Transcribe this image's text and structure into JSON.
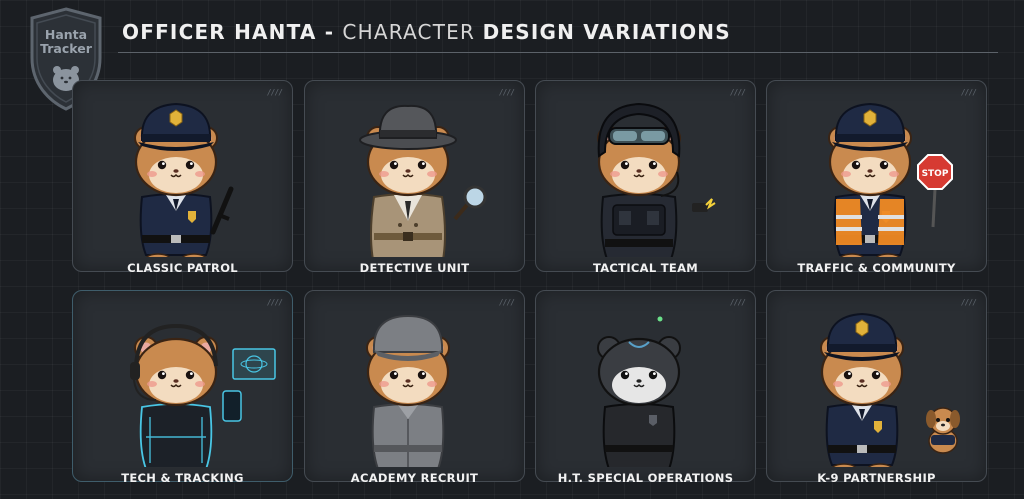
{
  "badge": {
    "line1": "Hanta",
    "line2": "Tracker"
  },
  "header": {
    "title_part1": "OFFICER HANTA - ",
    "title_part2": "CHARACTER ",
    "title_part3": "DESIGN VARIATIONS"
  },
  "cards": [
    {
      "label": "CLASSIC PATROL"
    },
    {
      "label": "DETECTIVE UNIT"
    },
    {
      "label": "TACTICAL TEAM"
    },
    {
      "label": "TRAFFIC & COMMUNITY"
    },
    {
      "label": "TECH & TRACKING"
    },
    {
      "label": "ACADEMY RECRUIT"
    },
    {
      "label": "H.T. SPECIAL OPERATIONS"
    },
    {
      "label": "K-9 PARTNERSHIP"
    }
  ],
  "stop_sign_text": "STOP",
  "colors": {
    "background": "#1b1e22",
    "card": "#2a2e33",
    "fur": "#c98a4f",
    "police_navy": "#1f2a44",
    "trench_coat": "#a89478",
    "tech_glow": "#49c6e5",
    "recruit_gray": "#7c7f84",
    "special_ops_black": "#26282c",
    "traffic_vest": "#f08a24"
  }
}
